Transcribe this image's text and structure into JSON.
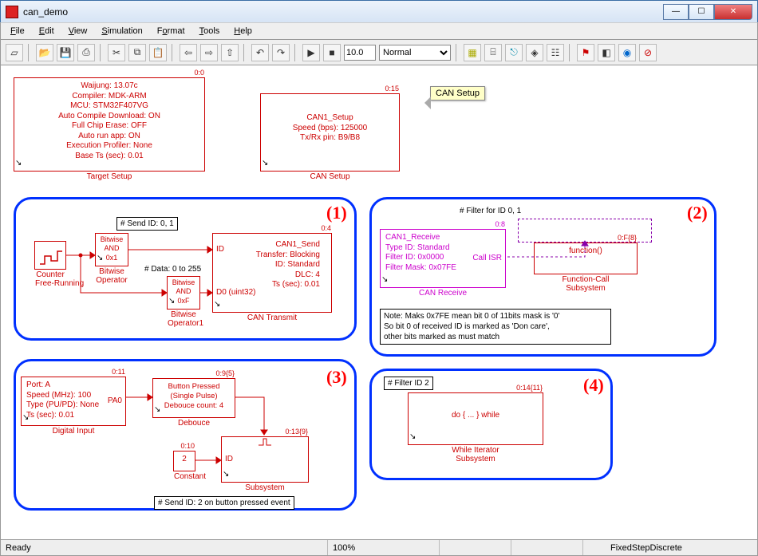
{
  "window": {
    "title": "can_demo"
  },
  "menus": {
    "file": "File",
    "edit": "Edit",
    "view": "View",
    "simulation": "Simulation",
    "format": "Format",
    "tools": "Tools",
    "help": "Help"
  },
  "toolbar": {
    "sim_time": "10.0",
    "sim_mode": "Normal"
  },
  "status": {
    "ready": "Ready",
    "zoom": "100%",
    "solver": "FixedStepDiscrete"
  },
  "labels": {
    "region1": "(1)",
    "region2": "(2)",
    "region3": "(3)",
    "region4": "(4)",
    "send_id_note": "# Send ID: 0, 1",
    "data_note": "# Data: 0 to 255",
    "filter_note": "# Filter for ID 0, 1",
    "filter_id2": "# Filter ID 2",
    "send_id_btn": "# Send ID: 2 on button pressed event",
    "mask_note_l1": "Note: Maks 0x7FE mean bit 0 of 11bits mask is '0'",
    "mask_note_l2": "So bit 0 of received ID is marked as 'Don care',",
    "mask_note_l3": "other bits marked as must match",
    "tooltip": "CAN Setup"
  },
  "blocks": {
    "target": {
      "ts": "0:0",
      "caption": "Target Setup",
      "lines": [
        "Waijung: 13.07c",
        "Compiler: MDK-ARM",
        "MCU: STM32F407VG",
        "Auto Compile Download: ON",
        "Full Chip Erase: OFF",
        "Auto run app: ON",
        "Execution Profiler: None",
        "Base Ts (sec): 0.01"
      ]
    },
    "cansetup": {
      "ts": "0:15",
      "caption": "CAN Setup",
      "lines": [
        "CAN1_Setup",
        "Speed (bps): 125000",
        "Tx/Rx pin: B9/B8"
      ]
    },
    "counter": {
      "caption_l1": "Counter",
      "caption_l2": "Free-Running"
    },
    "bw1": {
      "caption_l1": "Bitwise",
      "caption_l2": "Operator",
      "l1": "Bitwise",
      "l2": "AND",
      "l3": "0x1"
    },
    "bw2": {
      "caption_l1": "Bitwise",
      "caption_l2": "Operator1",
      "l1": "Bitwise",
      "l2": "AND",
      "l3": "0xF"
    },
    "cantx": {
      "ts": "0:4",
      "caption": "CAN Transmit",
      "port_id": "ID",
      "port_d0": "D0 (uint32)",
      "lines": [
        "CAN1_Send",
        "Transfer: Blocking",
        "ID: Standard",
        "DLC: 4",
        "Ts (sec): 0.01"
      ]
    },
    "canrx": {
      "ts": "0:8",
      "caption": "CAN Receive",
      "call_isr": "Call ISR",
      "lines": [
        "CAN1_Receive",
        "Type ID: Standard",
        "Filter ID: 0x0000",
        "Filter Mask: 0x07FE"
      ]
    },
    "fcsub": {
      "ts": "0:F{8}",
      "caption_l1": "Function-Call",
      "caption_l2": "Subsystem",
      "fn": "function()"
    },
    "diginput": {
      "ts": "0:11",
      "caption": "Digital Input",
      "port": "PA0",
      "lines": [
        "Port: A",
        "Speed (MHz): 100",
        "Type (PU/PD): None",
        "Ts (sec): 0.01"
      ]
    },
    "debounce": {
      "ts": "0:9{5}",
      "caption": "Debouce",
      "lines": [
        "Button Pressed",
        "(Single Pulse)",
        "Debouce count: 4"
      ]
    },
    "constant": {
      "ts": "0:10",
      "caption": "Constant",
      "val": "2"
    },
    "subsystem": {
      "ts": "0:13{9}",
      "caption": "Subsystem",
      "port_id": "ID"
    },
    "whileit": {
      "ts": "0:14{11}",
      "caption_l1": "While Iterator",
      "caption_l2": "Subsystem",
      "body": "do { ... } while"
    }
  }
}
